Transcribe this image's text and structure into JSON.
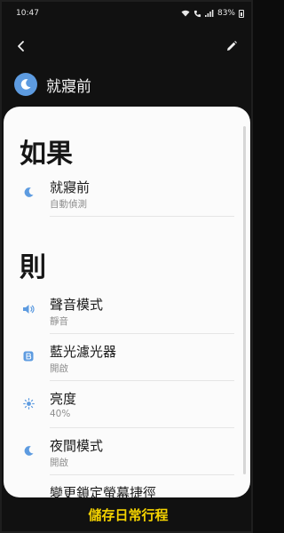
{
  "status_bar": {
    "time": "10:47",
    "battery": "83%"
  },
  "header": {
    "routine_name": "就寢前"
  },
  "sections": {
    "if_heading": "如果",
    "then_heading": "則"
  },
  "conditions": [
    {
      "title": "就寢前",
      "subtitle": "自動偵測",
      "icon": "moon-icon"
    }
  ],
  "actions": [
    {
      "title": "聲音模式",
      "subtitle": "靜音",
      "icon": "speaker-icon"
    },
    {
      "title": "藍光濾光器",
      "subtitle": "開啟",
      "icon": "blue-light-icon"
    },
    {
      "title": "亮度",
      "subtitle": "40%",
      "icon": "brightness-icon"
    },
    {
      "title": "夜間模式",
      "subtitle": "開啟",
      "icon": "moon-icon"
    },
    {
      "title": "變更鎖定螢幕捷徑",
      "subtitle": "",
      "icon": ""
    }
  ],
  "footer": {
    "save_label": "儲存日常行程"
  },
  "colors": {
    "accent_blue": "#5d9be0",
    "save_yellow": "#f5d300",
    "background": "#111111",
    "card": "#fbfbfb"
  }
}
